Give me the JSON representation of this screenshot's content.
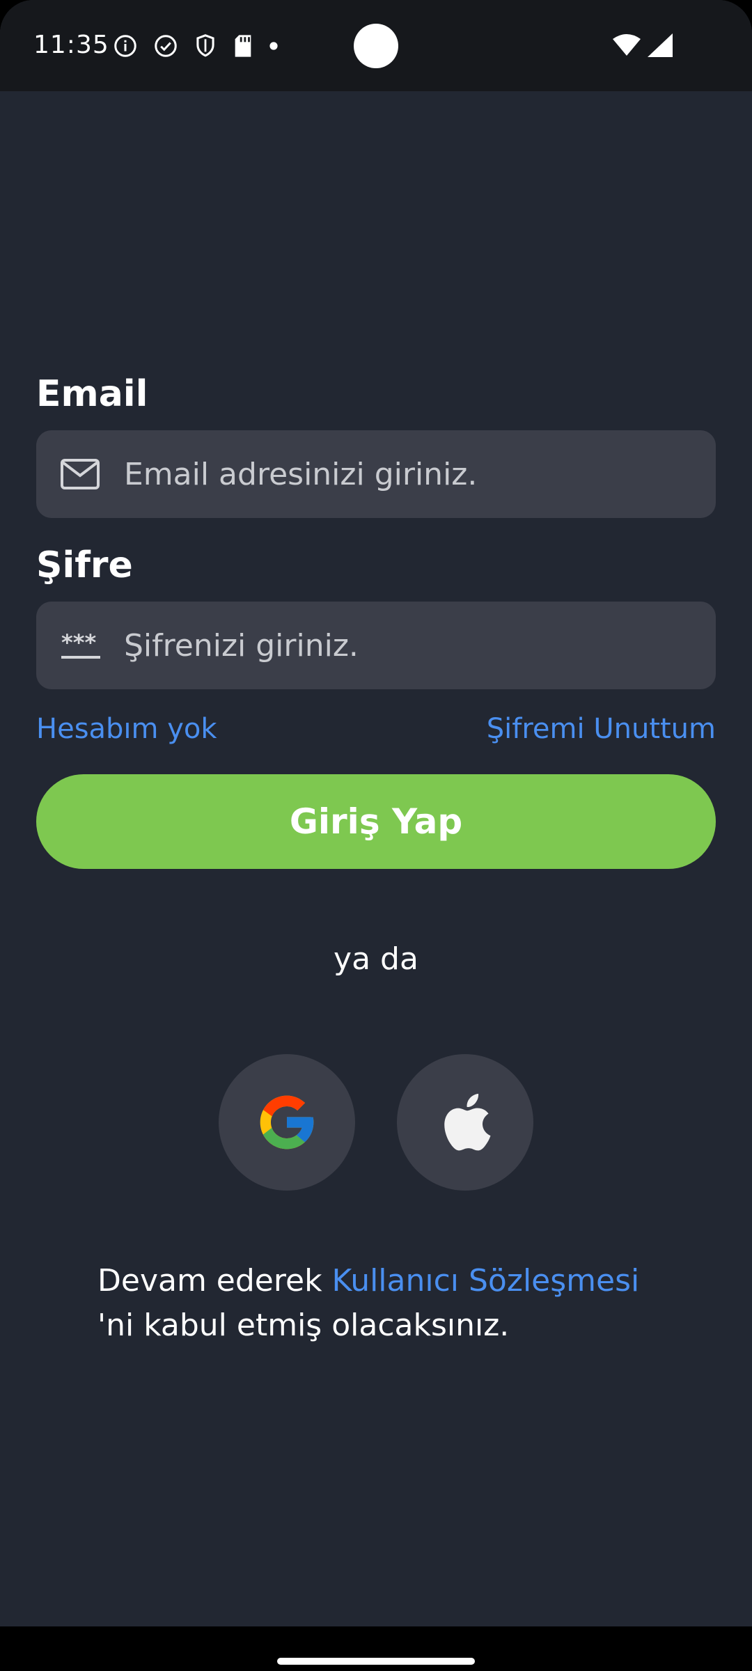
{
  "status_bar": {
    "time": "11:35",
    "icons": [
      "info-icon",
      "check-circle-icon",
      "shield-icon",
      "sd-card-icon",
      "dot-icon"
    ],
    "right_icons": [
      "wifi-icon",
      "signal-icon"
    ]
  },
  "form": {
    "email": {
      "label": "Email",
      "placeholder": "Email adresinizi giriniz.",
      "value": "",
      "icon": "mail-icon"
    },
    "password": {
      "label": "Şifre",
      "placeholder": "Şifrenizi giriniz.",
      "value": "",
      "icon": "password-dots-icon"
    },
    "no_account_link": "Hesabım yok",
    "forgot_password_link": "Şifremi Unuttum",
    "login_button": "Giriş Yap"
  },
  "divider_text": "ya da",
  "social": {
    "google": "google-icon",
    "apple": "apple-icon"
  },
  "legal": {
    "prefix": "Devam ederek ",
    "link": "Kullanıcı Sözleşmesi",
    "suffix": "'ni kabul etmiş olacaksınız."
  },
  "colors": {
    "background": "#222732",
    "field": "#3b3e49",
    "accent_link": "#4a8ff0",
    "primary_button": "#7ec850"
  }
}
